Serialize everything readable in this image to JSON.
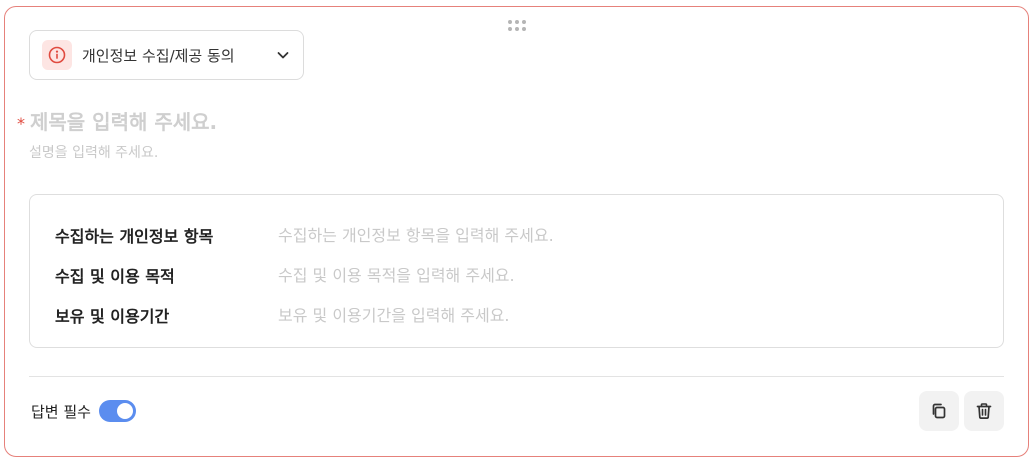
{
  "question_type": {
    "label": "개인정보 수집/제공 동의",
    "icon": "info-icon",
    "accent_color": "#e04a3f"
  },
  "question": {
    "title_placeholder": "제목을 입력해 주세요.",
    "description_placeholder": "설명을 입력해 주세요.",
    "required_marker": "*"
  },
  "privacy_items": [
    {
      "label": "수집하는 개인정보 항목",
      "placeholder": "수집하는 개인정보 항목을 입력해 주세요."
    },
    {
      "label": "수집 및 이용 목적",
      "placeholder": "수집 및 이용 목적을 입력해 주세요."
    },
    {
      "label": "보유 및 이용기간",
      "placeholder": "보유 및 이용기간을 입력해 주세요."
    }
  ],
  "footer": {
    "required_label": "답변 필수",
    "required_on": true,
    "toggle_color": "#5b8def",
    "copy_icon": "copy-icon",
    "delete_icon": "trash-icon"
  }
}
